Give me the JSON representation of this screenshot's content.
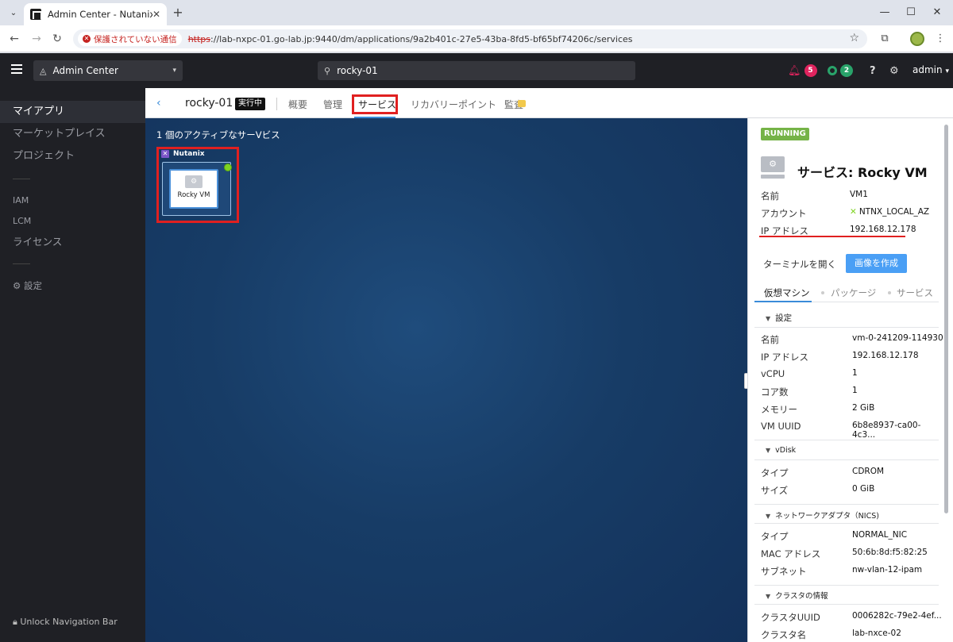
{
  "browser": {
    "tab_title": "Admin Center - Nutanix",
    "insecure_label": "保護されていない通信",
    "url_scheme": "https",
    "url_rest": "://lab-nxpc-01.go-lab.jp:9440/dm/applications/9a2b401c-27e5-43ba-8fd5-bf65bf74206c/services"
  },
  "header": {
    "app_switcher": "Admin Center",
    "search_value": "rocky-01",
    "alerts_count": "5",
    "tasks_count": "2",
    "user": "admin"
  },
  "sidebar": {
    "items": [
      "マイアプリ",
      "マーケットプレイス",
      "プロジェクト"
    ],
    "admin_items": [
      "IAM",
      "LCM",
      "ライセンス"
    ],
    "settings": "設定",
    "unlock": "Unlock Navigation Bar"
  },
  "content": {
    "app_name": "rocky-01",
    "state": "実行中",
    "tabs": [
      "概要",
      "管理",
      "サービス",
      "リカバリーポイント",
      "監査"
    ]
  },
  "canvas": {
    "title": "1 個のアクティブなサーVビス",
    "provider": "Nutanix",
    "service_name": "Rocky VM"
  },
  "panel": {
    "status": "RUNNING",
    "title": "サービス: Rocky VM",
    "summary": [
      {
        "k": "名前",
        "v": "VM1"
      },
      {
        "k": "アカウント",
        "v": "NTNX_LOCAL_AZ"
      },
      {
        "k": "IP アドレス",
        "v": "192.168.12.178"
      }
    ],
    "terminal_btn": "ターミナルを開く",
    "image_btn": "画像を作成",
    "subtabs": [
      "仮想マシン",
      "パッケージ",
      "サービス"
    ],
    "sec_settings": "設定",
    "settings_rows": [
      {
        "k": "名前",
        "v": "vm-0-241209-114930"
      },
      {
        "k": "IP アドレス",
        "v": "192.168.12.178"
      },
      {
        "k": "vCPU",
        "v": "1"
      },
      {
        "k": "コア数",
        "v": "1"
      },
      {
        "k": "メモリー",
        "v": "2 GiB"
      },
      {
        "k": "VM UUID",
        "v": "6b8e8937-ca00-4c3..."
      }
    ],
    "sec_vdisk": "vDisk",
    "vdisk_rows": [
      {
        "k": "タイプ",
        "v": "CDROM"
      },
      {
        "k": "サイズ",
        "v": "0 GiB"
      }
    ],
    "sec_nics": "ネットワークアダプタ（NICS)",
    "nic_rows": [
      {
        "k": "タイプ",
        "v": "NORMAL_NIC"
      },
      {
        "k": "MAC アドレス",
        "v": "50:6b:8d:f5:82:25"
      },
      {
        "k": "サブネット",
        "v": "nw-vlan-12-ipam"
      }
    ],
    "sec_cluster": "クラスタの情報",
    "cluster_rows": [
      {
        "k": "クラスタUUID",
        "v": "0006282c-79e2-4ef..."
      },
      {
        "k": "クラスタ名",
        "v": "lab-nxce-02"
      }
    ]
  }
}
